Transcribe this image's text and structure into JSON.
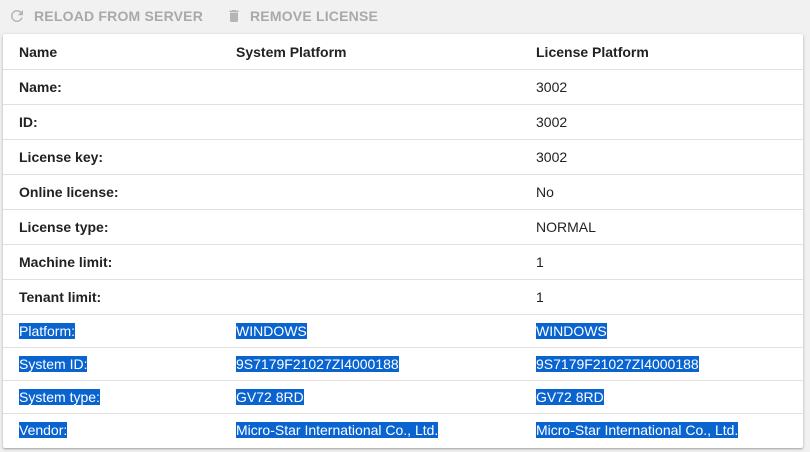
{
  "toolbar": {
    "reload_label": "RELOAD FROM SERVER",
    "remove_label": "REMOVE LICENSE"
  },
  "table": {
    "headers": [
      "Name",
      "System Platform",
      "License Platform"
    ],
    "rows": [
      {
        "label": "Name:",
        "system": "",
        "license": "3002"
      },
      {
        "label": "ID:",
        "system": "",
        "license": "3002"
      },
      {
        "label": "License key:",
        "system": "",
        "license": "3002"
      },
      {
        "label": "Online license:",
        "system": "",
        "license": "No"
      },
      {
        "label": "License type:",
        "system": "",
        "license": "NORMAL"
      },
      {
        "label": "Machine limit:",
        "system": "",
        "license": "1"
      },
      {
        "label": "Tenant limit:",
        "system": "",
        "license": "1"
      },
      {
        "label": "Platform:",
        "system": "WINDOWS",
        "license": "WINDOWS"
      },
      {
        "label": "System ID:",
        "system": "9S7179F21027ZI4000188",
        "license": "9S7179F21027ZI4000188"
      },
      {
        "label": "System type:",
        "system": "GV72 8RD",
        "license": "GV72 8RD"
      },
      {
        "label": "Vendor:",
        "system": "Micro-Star International Co., Ltd.",
        "license": "Micro-Star International Co., Ltd."
      }
    ]
  },
  "colors": {
    "selection": "#0a64d0",
    "toolbar_disabled": "#a9a9a9"
  }
}
